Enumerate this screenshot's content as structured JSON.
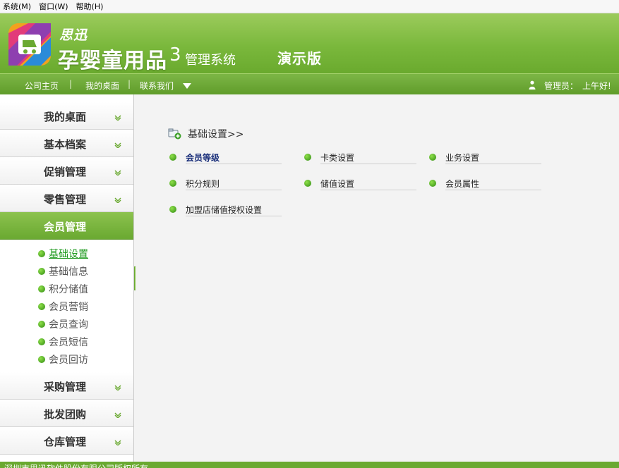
{
  "menubar": {
    "items": [
      "系统(M)",
      "窗口(W)",
      "帮助(H)"
    ]
  },
  "header": {
    "brand_small": "思迅",
    "brand_main": "孕婴童用品",
    "brand_num": "3",
    "brand_sys": "管理系统",
    "brand_demo": "演示版"
  },
  "navbar": {
    "links": [
      "公司主页",
      "我的桌面",
      "联系我们"
    ],
    "separator": "|",
    "user_label": "管理员：",
    "greeting": "上午好!"
  },
  "sidebar": {
    "menus_top": [
      "我的桌面",
      "基本档案",
      "促销管理",
      "零售管理"
    ],
    "active_menu": "会员管理",
    "submenu": [
      "基础设置",
      "基础信息",
      "积分储值",
      "会员营销",
      "会员查询",
      "会员短信",
      "会员回访"
    ],
    "menus_bottom": [
      "采购管理",
      "批发团购",
      "仓库管理"
    ]
  },
  "main": {
    "section_title": "基础设置>>",
    "items": [
      "会员等级",
      "卡类设置",
      "业务设置",
      "积分规则",
      "储值设置",
      "会员属性",
      "加盟店储值授权设置"
    ]
  },
  "footer": {
    "text": "深圳市思迅软件股份有限公司版权所有"
  },
  "colors": {
    "accent_green": "#6aa931",
    "header_green": "#7ab83c",
    "link_active": "#1f9a1f",
    "item_bold": "#1a2f7a"
  }
}
